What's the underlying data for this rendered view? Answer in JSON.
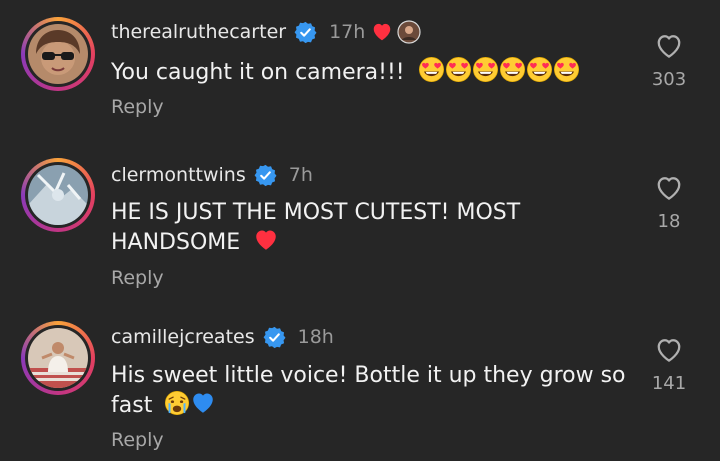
{
  "comments": [
    {
      "username": "therealruthecarter",
      "time": "17h",
      "text": "You caught it on camera!!!",
      "reply_label": "Reply",
      "likes": "303",
      "verified": true,
      "creator_liked": true
    },
    {
      "username": "clermonttwins",
      "time": "7h",
      "text_line1": "HE IS JUST THE MOST CUTEST! MOST",
      "text_line2": "HANDSOME",
      "reply_label": "Reply",
      "likes": "18",
      "verified": true
    },
    {
      "username": "camillejcreates",
      "time": "18h",
      "text_line1": "His sweet little voice! Bottle it up they grow so",
      "text_line2": "fast",
      "reply_label": "Reply",
      "likes": "141",
      "verified": true
    }
  ],
  "icons": {
    "verified": "verified-badge-icon",
    "like": "heart-outline-icon",
    "creator_heart": "red-heart-icon"
  },
  "colors": {
    "background": "#262626",
    "verified_blue": "#3797f0",
    "heart_red": "#ff3040",
    "muted_text": "#a8a8a8"
  }
}
